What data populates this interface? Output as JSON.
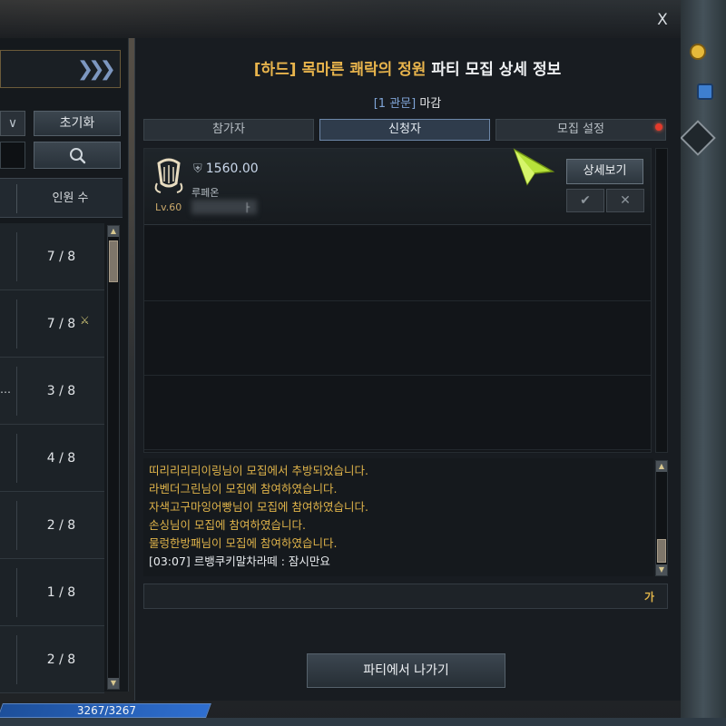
{
  "window": {
    "close_label": "X"
  },
  "dialog": {
    "title_highlight": "[하드] 목마른 쾌락의 정원",
    "title_rest": " 파티 모집 상세 정보",
    "subtitle_tag": "[1 관문]",
    "subtitle_status": " 마감"
  },
  "tabs": [
    {
      "label": "참가자",
      "active": false
    },
    {
      "label": "신청자",
      "active": true
    },
    {
      "label": "모집 설정",
      "active": false,
      "notification": true
    }
  ],
  "applicant": {
    "item_level": "1560.00",
    "class_name": "루페온",
    "level": "Lv.60",
    "name_suffix": "ㅏ",
    "detail_button": "상세보기",
    "accept_icon": "check-icon",
    "reject_icon": "x-icon"
  },
  "chat": {
    "lines": [
      {
        "text": "띠리리리리이링님이 모집에서 추방되었습니다.",
        "type": "system"
      },
      {
        "text": "라벤더그린님이 모집에 참여하였습니다.",
        "type": "system"
      },
      {
        "text": "자색고구마잉어빵님이 모집에 참여하였습니다.",
        "type": "system"
      },
      {
        "text": "손싱님이 모집에 참여하였습니다.",
        "type": "system"
      },
      {
        "text": "물렁한방패님이 모집에 참여하였습니다.",
        "type": "system"
      },
      {
        "text": "[03:07] 르뱅쿠키말차라떼 : 잠시만요",
        "type": "user"
      }
    ],
    "input_mode": "가"
  },
  "leave_button": "파티에서 나가기",
  "left_panel": {
    "reset_button": "초기화",
    "column_header": "인원 수",
    "dropdown_symbol": "∨",
    "rows": [
      {
        "count": "7 / 8",
        "extra": ""
      },
      {
        "count": "7 / 8",
        "extra": "⚔"
      },
      {
        "count": "3 / 8",
        "extra": "",
        "prefix": "…"
      },
      {
        "count": "4 / 8",
        "extra": ""
      },
      {
        "count": "2 / 8",
        "extra": ""
      },
      {
        "count": "1 / 8",
        "extra": ""
      },
      {
        "count": "2 / 8",
        "extra": ""
      }
    ]
  },
  "hud": {
    "hp_text": "3267/3267"
  },
  "colors": {
    "highlight": "#e8b44c",
    "system_chat": "#e0b44a",
    "notification": "#e33a2c"
  }
}
